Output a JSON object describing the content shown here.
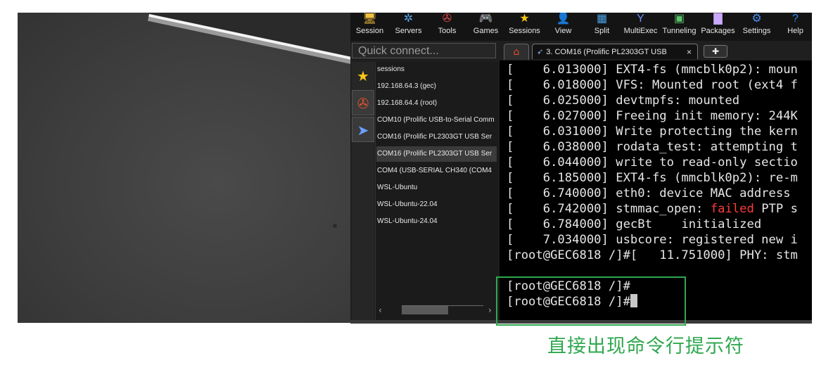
{
  "toolbar": [
    {
      "label": "Session",
      "icon": "monitor-icon",
      "glyph": "🖥",
      "color": "#f0c040"
    },
    {
      "label": "Servers",
      "icon": "servers-icon",
      "glyph": "✲",
      "color": "#58a6e8"
    },
    {
      "label": "Tools",
      "icon": "tools-icon",
      "glyph": "✇",
      "color": "#e04b4b"
    },
    {
      "label": "Games",
      "icon": "gamepad-icon",
      "glyph": "🎮",
      "color": "#dddddd"
    },
    {
      "label": "Sessions",
      "icon": "star-icon",
      "glyph": "★",
      "color": "#f5c518"
    },
    {
      "label": "View",
      "icon": "view-icon",
      "glyph": "👤",
      "color": "#6bbf59"
    },
    {
      "label": "Split",
      "icon": "split-icon",
      "glyph": "▦",
      "color": "#4aa3e8"
    },
    {
      "label": "MultiExec",
      "icon": "multiexec-icon",
      "glyph": "Y",
      "color": "#6c8cff"
    },
    {
      "label": "Tunneling",
      "icon": "tunneling-icon",
      "glyph": "▣",
      "color": "#5cc26a"
    },
    {
      "label": "Packages",
      "icon": "packages-icon",
      "glyph": "▇",
      "color": "#c9a8ff"
    },
    {
      "label": "Settings",
      "icon": "settings-icon",
      "glyph": "⚙",
      "color": "#4a8ef0"
    },
    {
      "label": "Help",
      "icon": "help-icon",
      "glyph": "?",
      "color": "#2f8cf0"
    }
  ],
  "quick_connect": {
    "placeholder": "Quick connect..."
  },
  "tabs": {
    "active_label": "3. COM16  (Prolific PL2303GT USB",
    "close_glyph": "×",
    "add_glyph": "✚",
    "home_glyph": "⌂"
  },
  "side_icons": [
    {
      "icon": "star-icon",
      "glyph": "★",
      "color": "#f5c518"
    },
    {
      "icon": "tools-icon",
      "glyph": "✇",
      "color": "#d9532f"
    },
    {
      "icon": "send-icon",
      "glyph": "➤",
      "color": "#6aa0ff"
    }
  ],
  "sessions": {
    "header": "sessions",
    "items": [
      "192.168.64.3 (gec)",
      "192.168.64.4 (root)",
      "COM10  (Prolific USB-to-Serial Comm",
      "COM16  (Prolific PL2303GT USB Ser",
      "COM16  (Prolific PL2303GT USB Ser",
      "COM4  (USB-SERIAL CH340 (COM4",
      "WSL-Ubuntu",
      "WSL-Ubuntu-22.04",
      "WSL-Ubuntu-24.04"
    ],
    "highlighted_index": 4,
    "scroll_left": "‹",
    "scroll_right": "›"
  },
  "terminal": {
    "lines": [
      {
        "pre": "[    6.013000] EXT4-fs (mmcblk0p2): moun",
        "err": "",
        "post": ""
      },
      {
        "pre": "[    6.018000] VFS: Mounted root (ext4 f",
        "err": "",
        "post": ""
      },
      {
        "pre": "[    6.025000] devtmpfs: mounted",
        "err": "",
        "post": ""
      },
      {
        "pre": "[    6.027000] Freeing init memory: 244K",
        "err": "",
        "post": ""
      },
      {
        "pre": "[    6.031000] Write protecting the kern",
        "err": "",
        "post": ""
      },
      {
        "pre": "[    6.038000] rodata_test: attempting t",
        "err": "",
        "post": ""
      },
      {
        "pre": "[    6.044000] write to read-only sectio",
        "err": "",
        "post": ""
      },
      {
        "pre": "[    6.185000] EXT4-fs (mmcblk0p2): re-m",
        "err": "",
        "post": ""
      },
      {
        "pre": "[    6.740000] eth0: device MAC address ",
        "err": "",
        "post": ""
      },
      {
        "pre": "[    6.742000] stmmac_open: ",
        "err": "failed",
        "post": " PTP s"
      },
      {
        "pre": "[    6.784000] gecBt    initialized",
        "err": "",
        "post": ""
      },
      {
        "pre": "[    7.034000] usbcore: registered new i",
        "err": "",
        "post": ""
      },
      {
        "pre": "[root@GEC6818 /]#[   11.751000] PHY: stm",
        "err": "",
        "post": ""
      },
      {
        "pre": "",
        "err": "",
        "post": ""
      },
      {
        "pre": "[root@GEC6818 /]#",
        "err": "",
        "post": ""
      },
      {
        "pre": "[root@GEC6818 /]#",
        "err": "",
        "post": "",
        "cursor": true
      }
    ],
    "error_color": "#ff3b3b"
  },
  "annotation": {
    "caption": "直接出现命令行提示符",
    "color": "#2fa84f"
  }
}
